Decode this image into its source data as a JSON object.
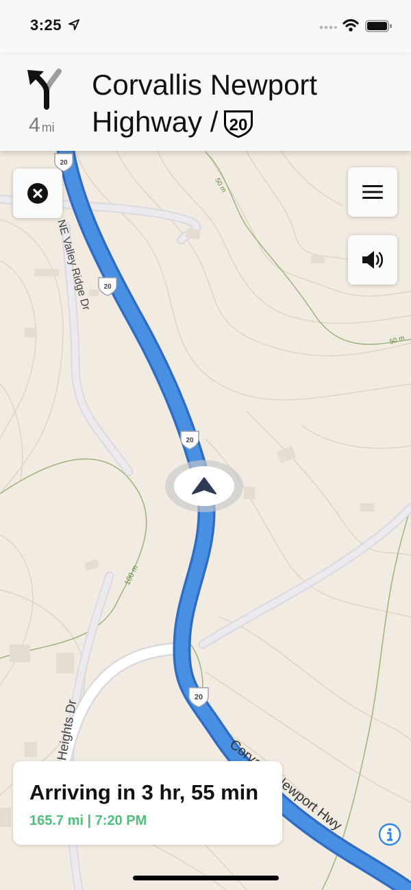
{
  "status_bar": {
    "time": "3:25"
  },
  "maneuver": {
    "distance_value": "4",
    "distance_unit": "mi",
    "road_name_line1": "Corvallis Newport",
    "road_name_line2": "Highway /",
    "shield_number": "20",
    "turn_icon": "keep-left-fork-icon"
  },
  "buttons": {
    "close": "close-icon",
    "menu": "menu-icon",
    "sound": "speaker-icon",
    "info": "info-icon"
  },
  "map": {
    "labels": {
      "valley_ridge": "NE Valley Ridge Dr",
      "heights": "Heights Dr",
      "hwy": "Corvallis Newport Hwy",
      "contour_50": "50 m",
      "contour_100": "100 m"
    },
    "shield_number": "20",
    "colors": {
      "route": "#4a90e2",
      "land": "#f1ebe1",
      "eta": "#4fbf7c"
    }
  },
  "route_card": {
    "arriving": "Arriving in 3 hr, 55 min",
    "details": "165.7 mi | 7:20 PM"
  }
}
